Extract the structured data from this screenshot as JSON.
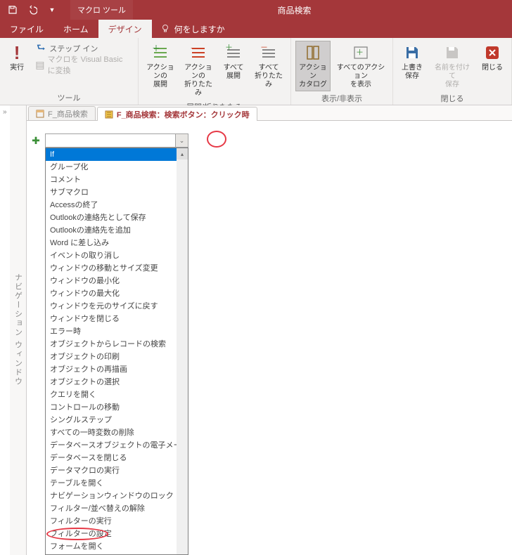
{
  "titlebar": {
    "tool_tab": "マクロ ツール",
    "window_title": "商品検索"
  },
  "menubar": {
    "file": "ファイル",
    "home": "ホーム",
    "design": "デザイン",
    "tellme": "何をしますか"
  },
  "ribbon": {
    "run": "実行",
    "step_in": "ステップ イン",
    "to_vb": "マクロを Visual Basic に変換",
    "group_tools": "ツール",
    "expand_actions": "アクションの\n展開",
    "collapse_actions": "アクションの\n折りたたみ",
    "expand_all": "すべて\n展開",
    "collapse_all": "すべて\n折りたたみ",
    "group_expand": "展開/折りたたみ",
    "action_catalog": "アクション\nカタログ",
    "show_all_actions": "すべてのアクション\nを表示",
    "group_show": "表示/非表示",
    "save": "上書き\n保存",
    "save_as": "名前を付けて\n保存",
    "close": "閉じる",
    "group_close": "閉じる"
  },
  "tabs": {
    "form": "F_商品検索",
    "macro": "F_商品検索：検索ボタン：クリック時"
  },
  "navpane": "ナビゲーション ウィンドウ",
  "dropdown": {
    "items": [
      "If",
      "グループ化",
      "コメント",
      "サブマクロ",
      "Accessの終了",
      "Outlookの連絡先として保存",
      "Outlookの連絡先を追加",
      "Word に差し込み",
      "イベントの取り消し",
      "ウィンドウの移動とサイズ変更",
      "ウィンドウの最小化",
      "ウィンドウの最大化",
      "ウィンドウを元のサイズに戻す",
      "ウィンドウを閉じる",
      "エラー時",
      "オブジェクトからレコードの検索",
      "オブジェクトの印刷",
      "オブジェクトの再描画",
      "オブジェクトの選択",
      "クエリを開く",
      "コントロールの移動",
      "シングルステップ",
      "すべての一時変数の削除",
      "データベースオブジェクトの電子メール送信",
      "データベースを閉じる",
      "データマクロの実行",
      "テーブルを開く",
      "ナビゲーションウィンドウのロック",
      "フィルター/並べ替えの解除",
      "フィルターの実行",
      "フィルターの設定",
      "フォームを開く"
    ]
  }
}
